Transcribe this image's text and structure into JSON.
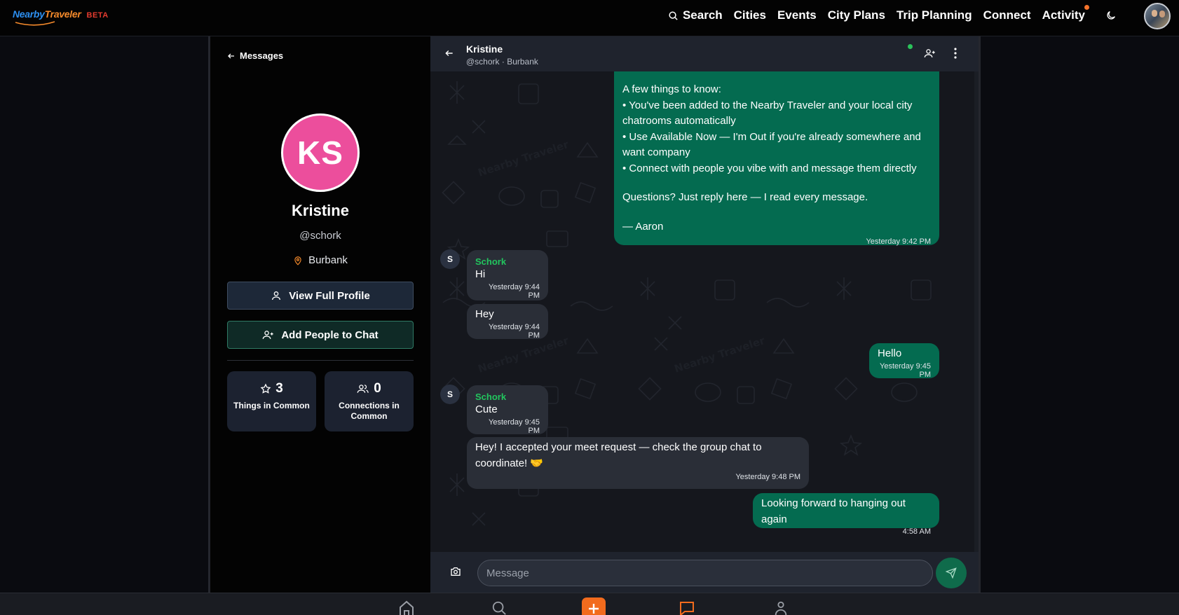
{
  "brand": {
    "word1": "Nearby",
    "word2": "Traveler",
    "badge": "BETA"
  },
  "nav": {
    "items": [
      {
        "label": "Search",
        "icon": "search-icon"
      },
      {
        "label": "Cities"
      },
      {
        "label": "Events"
      },
      {
        "label": "City Plans"
      },
      {
        "label": "Trip Planning"
      },
      {
        "label": "Connect"
      },
      {
        "label": "Activity",
        "notification_dot": true
      }
    ],
    "theme_toggle_icon": "moon-icon"
  },
  "profile": {
    "back_label": "Messages",
    "initials": "KS",
    "name": "Kristine",
    "handle": "@schork",
    "location": "Burbank",
    "view_profile_label": "View Full Profile",
    "add_people_label": "Add People to Chat",
    "stats": [
      {
        "value": "3",
        "label": "Things in Common",
        "icon": "star-icon"
      },
      {
        "value": "0",
        "label": "Connections in Common",
        "icon": "users-icon"
      }
    ]
  },
  "chat": {
    "header": {
      "name": "Kristine",
      "subtitle": "@schork · Burbank",
      "online": true
    },
    "messages": [
      {
        "direction": "out",
        "lines": [
          "A few things to know:",
          "• You've been added to the Nearby Traveler and your local city chatrooms automatically",
          "• Use Available Now — I'm Out if you're already somewhere and want company",
          "• Connect with people you vibe with and message them directly",
          "",
          "Questions? Just reply here — I read every message.",
          "",
          "— Aaron"
        ],
        "time": "Yesterday 9:42 PM"
      },
      {
        "direction": "in",
        "sender": "Schork",
        "avatar": "S",
        "text": "Hi",
        "time": "Yesterday 9:44 PM"
      },
      {
        "direction": "in",
        "text": "Hey",
        "time": "Yesterday 9:44 PM"
      },
      {
        "direction": "out",
        "text": "Hello",
        "time": "Yesterday 9:45 PM"
      },
      {
        "direction": "in",
        "sender": "Schork",
        "avatar": "S",
        "text": "Cute",
        "time": "Yesterday 9:45 PM"
      },
      {
        "direction": "in",
        "text": "Hey! I accepted your meet request — check the group chat to coordinate! 🤝",
        "time": "Yesterday 9:48 PM"
      },
      {
        "direction": "out",
        "text": "Looking forward to hanging out again",
        "time": "4:58 AM"
      }
    ],
    "composer": {
      "placeholder": "Message"
    },
    "watermark": "Nearby Traveler"
  },
  "bottom_nav": [
    "home-icon",
    "search-icon",
    "plus-icon",
    "messages-icon",
    "profile-icon"
  ],
  "colors": {
    "brand_blue": "#2d8ff0",
    "brand_orange": "#f58a2b",
    "beta_red": "#e53b2f",
    "outgoing_bubble": "#046b50",
    "incoming_bubble": "#2a2e37",
    "sender_name": "#22c55e",
    "avatar_pink": "#ec4e9c",
    "accent_orange": "#f26b1d"
  }
}
